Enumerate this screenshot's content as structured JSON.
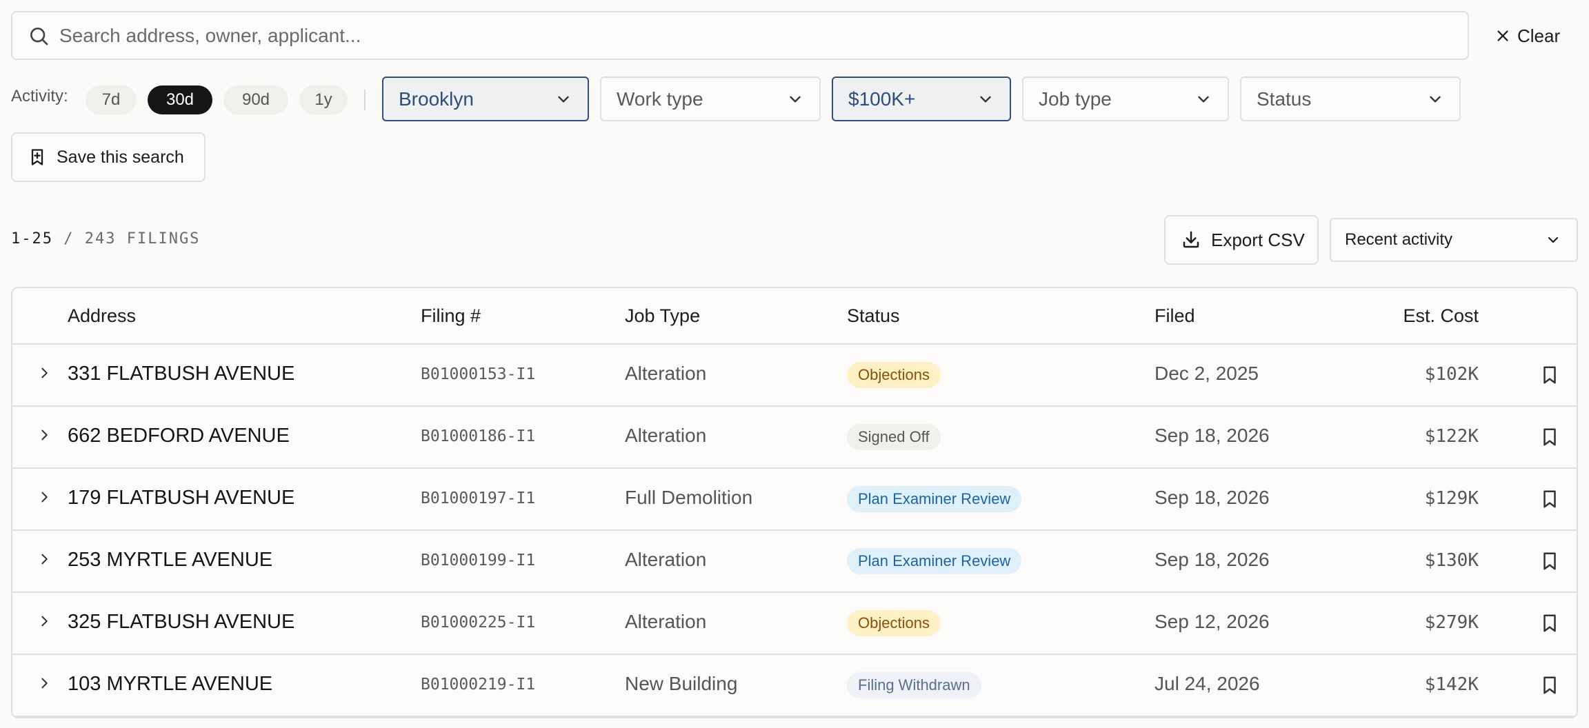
{
  "search": {
    "placeholder": "Search address, owner, applicant...",
    "clear_label": "Clear"
  },
  "filters": {
    "activity_label": "Activity:",
    "ranges": [
      {
        "label": "7d",
        "active": false
      },
      {
        "label": "30d",
        "active": true
      },
      {
        "label": "90d",
        "active": false
      },
      {
        "label": "1y",
        "active": false
      }
    ],
    "borough": {
      "value": "Brooklyn",
      "active": true
    },
    "work_type": {
      "value": "Work type",
      "active": false
    },
    "cost": {
      "value": "$100K+",
      "active": true
    },
    "job_type": {
      "value": "Job type",
      "active": false
    },
    "status": {
      "value": "Status",
      "active": false
    },
    "save_label": "Save this search"
  },
  "results": {
    "range": "1-25",
    "separator": " / ",
    "total_label": "243 FILINGS",
    "export_label": "Export CSV",
    "sort_value": "Recent activity"
  },
  "table": {
    "columns": {
      "address": "Address",
      "filing": "Filing #",
      "job_type": "Job Type",
      "status": "Status",
      "filed": "Filed",
      "cost": "Est. Cost"
    },
    "rows": [
      {
        "address": "331 FLATBUSH AVENUE",
        "filing": "B01000153-I1",
        "job_type": "Alteration",
        "status": "Objections",
        "status_kind": "objections",
        "filed": "Dec 2, 2025",
        "cost": "$102K"
      },
      {
        "address": "662 BEDFORD AVENUE",
        "filing": "B01000186-I1",
        "job_type": "Alteration",
        "status": "Signed Off",
        "status_kind": "signed",
        "filed": "Sep 18, 2026",
        "cost": "$122K"
      },
      {
        "address": "179 FLATBUSH AVENUE",
        "filing": "B01000197-I1",
        "job_type": "Full Demolition",
        "status": "Plan Examiner Review",
        "status_kind": "review",
        "filed": "Sep 18, 2026",
        "cost": "$129K"
      },
      {
        "address": "253 MYRTLE AVENUE",
        "filing": "B01000199-I1",
        "job_type": "Alteration",
        "status": "Plan Examiner Review",
        "status_kind": "review",
        "filed": "Sep 18, 2026",
        "cost": "$130K"
      },
      {
        "address": "325 FLATBUSH AVENUE",
        "filing": "B01000225-I1",
        "job_type": "Alteration",
        "status": "Objections",
        "status_kind": "objections",
        "filed": "Sep 12, 2026",
        "cost": "$279K"
      },
      {
        "address": "103 MYRTLE AVENUE",
        "filing": "B01000219-I1",
        "job_type": "New Building",
        "status": "Filing Withdrawn",
        "status_kind": "withdrawn",
        "filed": "Jul 24, 2026",
        "cost": "$142K"
      }
    ]
  },
  "colors": {
    "status_objections_bg": "#fdf0c4",
    "status_objections_fg": "#8a4f08",
    "status_signed_bg": "#f1f0ed",
    "status_signed_fg": "#555555",
    "status_review_bg": "#dff0fb",
    "status_review_fg": "#1d64a0",
    "status_withdrawn_bg": "#eef1f5",
    "status_withdrawn_fg": "#5b6f8a",
    "active_filter_border": "#2d4f7c",
    "active_chip_bg": "#151515"
  },
  "icons": {
    "search": "search-icon",
    "clear": "close-icon",
    "dropdown": "chevron-down-icon",
    "save": "bookmark-plus-icon",
    "export": "download-icon",
    "expand": "chevron-right-icon",
    "bookmark": "bookmark-icon"
  }
}
